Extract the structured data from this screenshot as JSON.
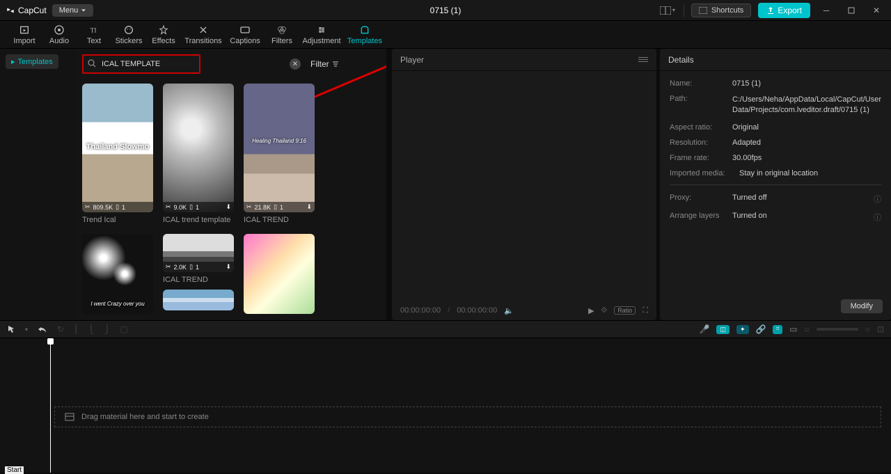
{
  "app": {
    "name": "CapCut",
    "menu_label": "Menu",
    "project_title": "0715 (1)"
  },
  "titlebar_buttons": {
    "shortcuts": "Shortcuts",
    "export": "Export"
  },
  "tabs": [
    {
      "id": "import",
      "label": "Import"
    },
    {
      "id": "audio",
      "label": "Audio"
    },
    {
      "id": "text",
      "label": "Text"
    },
    {
      "id": "stickers",
      "label": "Stickers"
    },
    {
      "id": "effects",
      "label": "Effects"
    },
    {
      "id": "transitions",
      "label": "Transitions"
    },
    {
      "id": "captions",
      "label": "Captions"
    },
    {
      "id": "filters",
      "label": "Filters"
    },
    {
      "id": "adjustment",
      "label": "Adjustment"
    },
    {
      "id": "templates",
      "label": "Templates",
      "active": true
    }
  ],
  "sidebar": {
    "category": "Templates"
  },
  "search": {
    "value": "ICAL TEMPLATE",
    "filter_label": "Filter"
  },
  "templates": [
    {
      "title": "Trend Ical",
      "views": "809.5K",
      "count": "1",
      "overlay": "Thailand Slowmo",
      "bg": "bg1"
    },
    {
      "title": "ICAL trend template",
      "views": "9.0K",
      "count": "1",
      "overlay": "",
      "bg": "bg2",
      "dl": true
    },
    {
      "title": "ICAL TREND",
      "views": "21.8K",
      "count": "1",
      "overlay": "Healing Thailand 9:16",
      "bg": "bg3",
      "dl": true
    },
    {
      "title": "",
      "views": "",
      "count": "",
      "overlay": "I went Crazy over you",
      "bg": "bg4"
    },
    {
      "title": "ICAL TREND",
      "views": "2.0K",
      "count": "1",
      "overlay": "",
      "bg": "bg5",
      "dl": true,
      "small": true
    },
    {
      "title": "",
      "views": "",
      "count": "",
      "overlay": "",
      "bg": "bg6"
    }
  ],
  "extra_thumb": {
    "bg": "bg7"
  },
  "player": {
    "title": "Player",
    "time_current": "00:00:00:00",
    "time_total": "00:00:00:00",
    "ratio_label": "Ratio"
  },
  "details": {
    "title": "Details",
    "rows": {
      "name_k": "Name:",
      "name_v": "0715 (1)",
      "path_k": "Path:",
      "path_v": "C:/Users/Neha/AppData/Local/CapCut/User Data/Projects/com.lveditor.draft/0715 (1)",
      "aspect_k": "Aspect ratio:",
      "aspect_v": "Original",
      "res_k": "Resolution:",
      "res_v": "Adapted",
      "fr_k": "Frame rate:",
      "fr_v": "30.00fps",
      "imp_k": "Imported media:",
      "imp_v": "Stay in original location",
      "proxy_k": "Proxy:",
      "proxy_v": "Turned off",
      "arr_k": "Arrange layers",
      "arr_v": "Turned on"
    },
    "modify_label": "Modify"
  },
  "timeline": {
    "drop_hint": "Drag material here and start to create",
    "start_label": "Start"
  }
}
